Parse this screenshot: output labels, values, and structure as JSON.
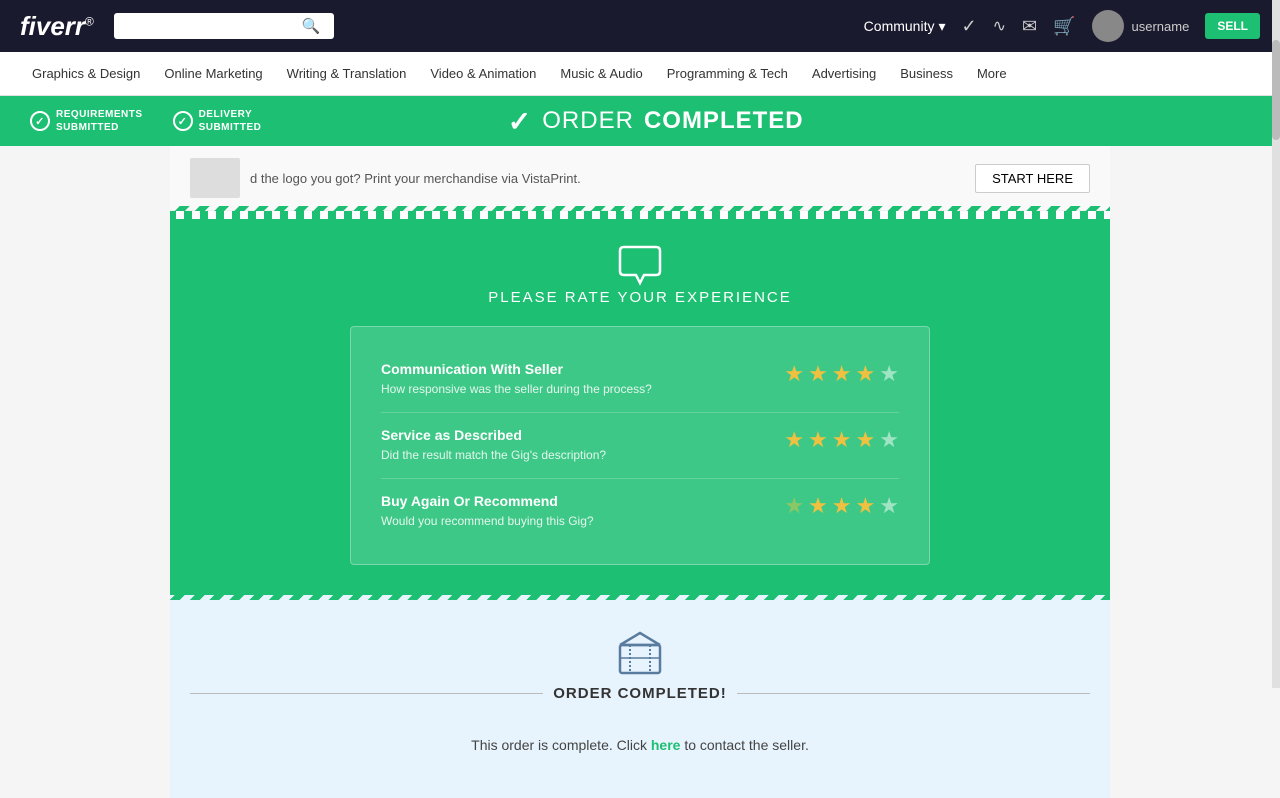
{
  "topNav": {
    "logo": "fiverr",
    "logoSup": "®",
    "search": {
      "placeholder": "",
      "value": ""
    },
    "communityLabel": "Community",
    "navIcons": {
      "check": "✓",
      "analytics": "⟆",
      "mail": "✉",
      "cart": "🛒"
    },
    "username": "username",
    "becomeSellerLabel": "SELL"
  },
  "secondaryNav": {
    "items": [
      {
        "label": "Graphics & Design",
        "id": "graphics-design"
      },
      {
        "label": "Online Marketing",
        "id": "online-marketing"
      },
      {
        "label": "Writing & Translation",
        "id": "writing-translation"
      },
      {
        "label": "Video & Animation",
        "id": "video-animation"
      },
      {
        "label": "Music & Audio",
        "id": "music-audio"
      },
      {
        "label": "Programming & Tech",
        "id": "programming-tech"
      },
      {
        "label": "Advertising",
        "id": "advertising"
      },
      {
        "label": "Business",
        "id": "business"
      },
      {
        "label": "More",
        "id": "more"
      }
    ]
  },
  "orderBanner": {
    "step1Label": "REQUIREMENTS\nSUBMITTED",
    "step2Label": "DELIVERY\nSUBMITTED",
    "orderWord": "ORDER",
    "completedWord": "COMPLETED",
    "checkmark": "✓"
  },
  "vistaPrint": {
    "text": "d the logo you got? Print your merchandise via VistaPrint.",
    "buttonLabel": "START HERE"
  },
  "ratingSection": {
    "headerIcon": "💬",
    "headerText": "PLEASE RATE YOUR EXPERIENCE",
    "rows": [
      {
        "id": "communication",
        "title": "Communication With Seller",
        "description": "How responsive was the seller during the process?",
        "filledStars": 4,
        "emptyStars": 1
      },
      {
        "id": "service",
        "title": "Service as Described",
        "description": "Did the result match the Gig's description?",
        "filledStars": 4,
        "emptyStars": 1
      },
      {
        "id": "recommend",
        "title": "Buy Again Or Recommend",
        "description": "Would you recommend buying this Gig?",
        "filledStars": 3,
        "emptyStars": 2
      }
    ]
  },
  "orderCompletedSection": {
    "boxIcon": "📦",
    "label": "ORDER COMPLETED!",
    "message": "This order is complete. Click",
    "linkText": "here",
    "messageSuffix": "to contact the seller."
  }
}
